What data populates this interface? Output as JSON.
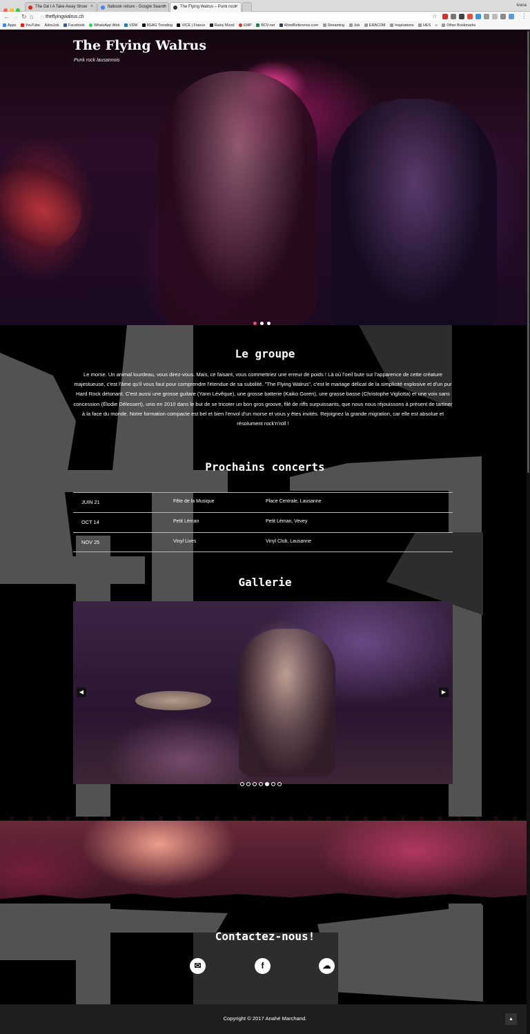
{
  "browser": {
    "tabs": [
      {
        "title": "The Dø I A Take Away Show",
        "favicon_color": "#e62117",
        "active": false
      },
      {
        "title": "flatbook reliure - Google Search",
        "favicon_color": "#4285f4",
        "active": false
      },
      {
        "title": "The Flying Walrus – Punk rock",
        "favicon_color": "#333333",
        "active": true
      }
    ],
    "user": "Ivana",
    "url": "theflyingwalrus.ch",
    "bookmarks": [
      "Apps",
      "YouTube",
      "AdosJob",
      "Facebook",
      "WhatsApp Web",
      "VDM",
      "9GAG Trending",
      "VICE | France",
      "Rainy Mood",
      "EMP",
      "BCV-net",
      "WordReference.com",
      "Streaming",
      "Job",
      "ERACOM",
      "Inspirations",
      "HES",
      "»",
      "Other Bookmarks"
    ]
  },
  "site": {
    "title": "The Flying Walrus",
    "tagline": "Punk rock lausannois",
    "hero_slides": 3,
    "hero_active_slide": 1
  },
  "about": {
    "heading": "Le groupe",
    "text": "Le morse. Un animal lourdeau, vous direz-vous. Mais, ce faisant, vous commettriez une erreur de poids ! Là où l'oeil bute sur l'apparence de cette créature majestueuse, c'est l'âme qu'il vous faut pour comprendre l'étendue de sa subtilité. \"The Flying Walrus\", c'est le mariage délicat de la simplicité explosive et d'un pur Hard Rock détonant. C'est aussi une grosse guitare (Yann Lévêque), une grosse batterie (Kaiko Goren), une grasse basse (Christophe Vigliotta) et une voix sans concession (Élodie Délessert), unis en 2010 dans le but de se tricoter un bon gros groove, filé de riffs surpuissants, que nous nous réjouissons à présent de tartiner à la face du monde. Notre formation compacte est bel et bien l'envol d'un morse et vous y êtes invités. Rejoignez la grande migration, car elle est absolue et résolument rock'n'roll !"
  },
  "concerts": {
    "heading": "Prochains concerts",
    "rows": [
      {
        "date": "JUIN 21",
        "event": "Fête de la Musique",
        "venue": "Place Centrale, Lausanne"
      },
      {
        "date": "OCT 14",
        "event": "Petit Léman",
        "venue": "Petit Léman, Vevey"
      },
      {
        "date": "NOV 25",
        "event": "Vinyl Lives",
        "venue": "Vinyl Club, Lausanne"
      }
    ]
  },
  "gallery": {
    "heading": "Gallerie",
    "prev_icon": "chevron-left-icon",
    "next_icon": "chevron-right-icon",
    "slides": 7,
    "active_slide": 5
  },
  "contact": {
    "heading": "Contactez-nous!",
    "links": [
      {
        "icon": "mail-icon",
        "glyph": "✉"
      },
      {
        "icon": "facebook-icon",
        "glyph": "f"
      },
      {
        "icon": "soundcloud-icon",
        "glyph": "☁"
      }
    ]
  },
  "footer": {
    "copyright": "Copyright © 2017 Anahé Marchand.",
    "to_top_icon": "chevron-up-icon"
  },
  "colors": {
    "accent": "#e74c6f",
    "footer_bg": "#1e1e1e",
    "grunge_grey": "#525252"
  }
}
